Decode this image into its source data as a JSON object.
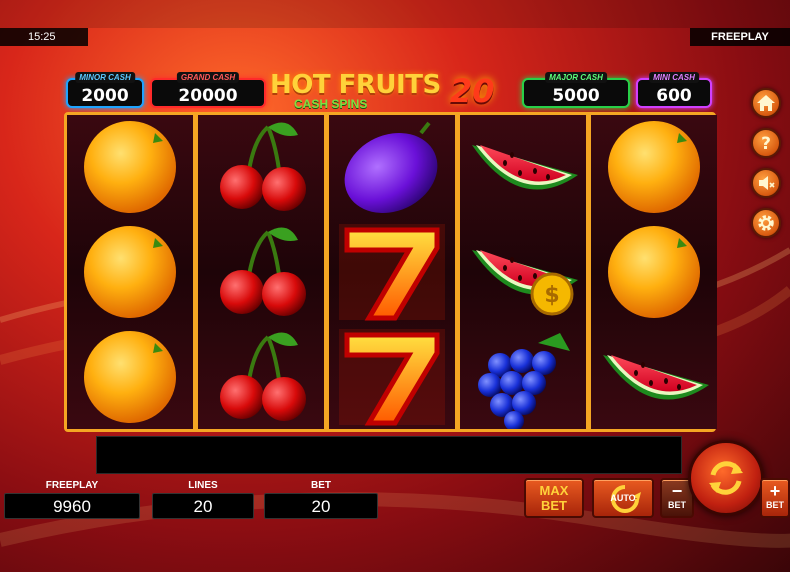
{
  "status": {
    "time": "15:25",
    "mode": "FREEPLAY"
  },
  "jackpots": {
    "minor": {
      "label": "MINOR CASH",
      "value": "2000"
    },
    "grand": {
      "label": "GRAND CASH",
      "value": "20000"
    },
    "major": {
      "label": "MAJOR CASH",
      "value": "5000"
    },
    "mini": {
      "label": "MINI CASH",
      "value": "600"
    }
  },
  "logo": {
    "line1": "HOT FRUITS",
    "line2": "CASH SPINS",
    "number": "20"
  },
  "reels": [
    [
      "orange",
      "orange",
      "orange"
    ],
    [
      "cherry",
      "cherry",
      "cherry"
    ],
    [
      "plum",
      "seven",
      "seven"
    ],
    [
      "watermelon",
      "watermelon-coin",
      "grapes"
    ],
    [
      "orange",
      "orange",
      "watermelon"
    ]
  ],
  "side_menu": [
    "home-icon",
    "help-icon",
    "sound-off-icon",
    "settings-icon"
  ],
  "info": {
    "freeplay": {
      "label": "FREEPLAY",
      "value": "9960"
    },
    "lines": {
      "label": "LINES",
      "value": "20"
    },
    "bet": {
      "label": "BET",
      "value": "20"
    }
  },
  "controls": {
    "max_bet": "MAX\nBET",
    "auto": "AUTO",
    "bet_minus_sign": "−",
    "bet_minus_label": "BET",
    "bet_plus_sign": "+",
    "bet_plus_label": "BET"
  },
  "colors": {
    "accent": "#f5a623",
    "minor": "#1ea3ff",
    "grand": "#ff2a2a",
    "major": "#28d048",
    "mini": "#d040ff"
  }
}
